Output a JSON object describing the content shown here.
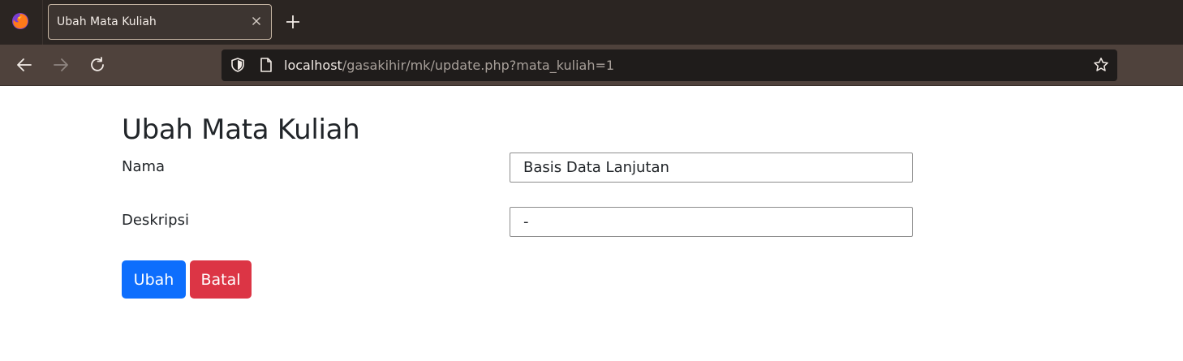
{
  "browser": {
    "tab": {
      "title": "Ubah Mata Kuliah"
    },
    "url": {
      "host": "localhost",
      "path": "/gasakihir/mk/update.php?mata_kuliah=1"
    },
    "icons": [
      "firefox-logo",
      "tab-close-icon",
      "new-tab-icon",
      "back-icon",
      "forward-icon",
      "reload-icon",
      "shield-icon",
      "page-icon",
      "bookmark-star-icon"
    ]
  },
  "page": {
    "title": "Ubah Mata Kuliah",
    "fields": {
      "nama": {
        "label": "Nama",
        "value": "Basis Data Lanjutan"
      },
      "deskripsi": {
        "label": "Deskripsi",
        "value": "-"
      }
    },
    "buttons": {
      "ubah": "Ubah",
      "batal": "Batal"
    }
  },
  "colors": {
    "primary": "#0d6efd",
    "danger": "#dc3545",
    "chrome_dark": "#2b2522",
    "navbar": "#4f423c",
    "urlbar": "#1f1c1b"
  }
}
